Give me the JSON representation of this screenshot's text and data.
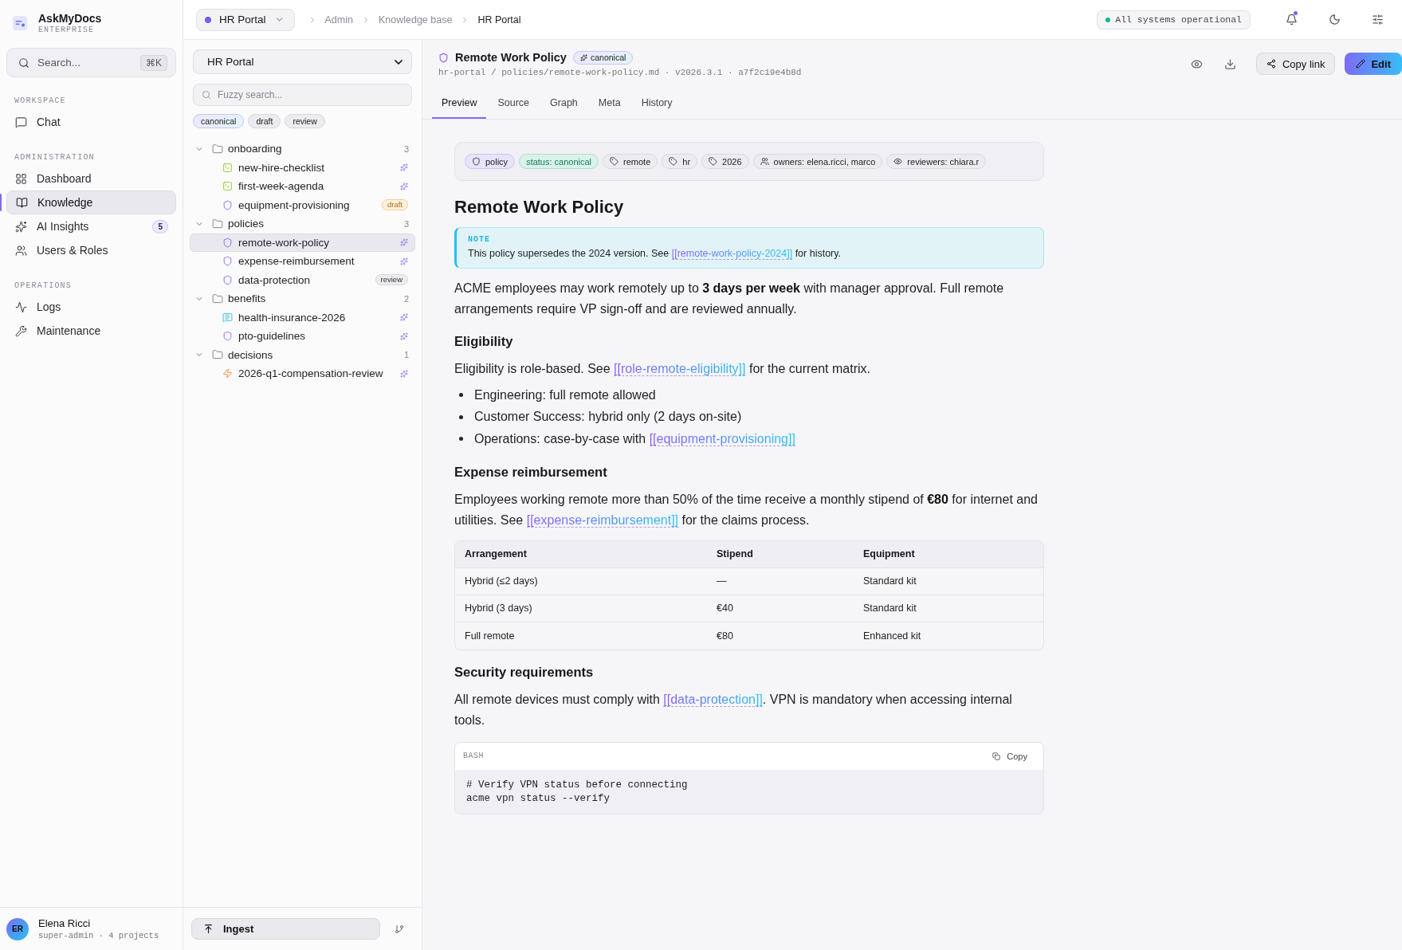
{
  "app": {
    "name": "AskMyDocs",
    "edition": "ENTERPRISE"
  },
  "sidebar": {
    "search": {
      "placeholder": "Search...",
      "shortcut": "⌘K"
    },
    "sections": [
      {
        "title": "WORKSPACE",
        "items": [
          {
            "label": "Chat",
            "selected": false
          }
        ]
      },
      {
        "title": "ADMINISTRATION",
        "items": [
          {
            "label": "Dashboard",
            "selected": false
          },
          {
            "label": "Knowledge",
            "selected": true
          },
          {
            "label": "AI Insights",
            "selected": false,
            "badge": "5"
          },
          {
            "label": "Users & Roles",
            "selected": false
          }
        ]
      },
      {
        "title": "OPERATIONS",
        "items": [
          {
            "label": "Logs",
            "selected": false
          },
          {
            "label": "Maintenance",
            "selected": false
          }
        ]
      }
    ]
  },
  "user": {
    "initials": "ER",
    "name": "Elena Ricci",
    "meta": "super-admin · 4 projects"
  },
  "topbar": {
    "project": "HR Portal",
    "breadcrumbs": [
      "Admin",
      "Knowledge base",
      "HR Portal"
    ],
    "status": "All systems operational",
    "unread_notifications": true
  },
  "tree_panel": {
    "project_select": "HR Portal",
    "search": {
      "placeholder": "Fuzzy search..."
    },
    "filters": [
      {
        "label": "canonical",
        "selected": true
      },
      {
        "label": "draft",
        "selected": false
      },
      {
        "label": "review",
        "selected": false
      }
    ],
    "folders": [
      {
        "name": "onboarding",
        "count": "3",
        "expanded": true,
        "children": [
          {
            "name": "new-hire-checklist",
            "kind": "terminal",
            "selected": false
          },
          {
            "name": "first-week-agenda",
            "kind": "terminal",
            "selected": false
          },
          {
            "name": "equipment-provisioning",
            "kind": "shield",
            "selected": false,
            "badge": {
              "label": "draft",
              "kind": "warning"
            }
          }
        ]
      },
      {
        "name": "policies",
        "count": "3",
        "expanded": true,
        "children": [
          {
            "name": "remote-work-policy",
            "kind": "shield",
            "selected": true
          },
          {
            "name": "expense-reimbursement",
            "kind": "shield",
            "selected": false
          },
          {
            "name": "data-protection",
            "kind": "shield",
            "selected": false,
            "badge": {
              "label": "review",
              "kind": "neutral"
            }
          }
        ]
      },
      {
        "name": "benefits",
        "count": "2",
        "expanded": true,
        "children": [
          {
            "name": "health-insurance-2026",
            "kind": "chat",
            "selected": false
          },
          {
            "name": "pto-guidelines",
            "kind": "shield",
            "selected": false
          }
        ]
      },
      {
        "name": "decisions",
        "count": "1",
        "expanded": true,
        "children": [
          {
            "name": "2026-q1-compensation-review",
            "kind": "bolt",
            "selected": false
          }
        ]
      }
    ],
    "ingest_button": "Ingest"
  },
  "document": {
    "title": "Remote Work Policy",
    "status": "canonical",
    "path": "hr-portal / policies/remote-work-policy.md · v2026.3.1 · a7f2c19e4b8d",
    "copy_link": "Copy link",
    "edit": "Edit",
    "tabs": [
      {
        "label": "Preview",
        "selected": true
      },
      {
        "label": "Source",
        "selected": false
      },
      {
        "label": "Graph",
        "selected": false
      },
      {
        "label": "Meta",
        "selected": false
      },
      {
        "label": "History",
        "selected": false
      }
    ],
    "meta_chips": [
      {
        "label": "policy",
        "kind": "type"
      },
      {
        "label": "status: canonical",
        "kind": "status"
      },
      {
        "label": "remote",
        "kind": "tag"
      },
      {
        "label": "hr",
        "kind": "tag"
      },
      {
        "label": "2026",
        "kind": "tag"
      },
      {
        "label": "owners: elena.ricci, marco",
        "kind": "owners"
      },
      {
        "label": "reviewers: chiara.r",
        "kind": "reviewers"
      }
    ],
    "heading": "Remote Work Policy",
    "note": {
      "label": "NOTE",
      "segments": [
        {
          "text": "This policy supersedes the 2024 version. See "
        },
        {
          "link": "[[remote-work-policy-2024]]"
        },
        {
          "text": " for history."
        }
      ]
    },
    "blocks": [
      {
        "kind": "paragraph",
        "segments": [
          {
            "text": "ACME employees may work remotely up to **3 days per week** with manager approval. Full remote arrangements require VP sign-off and are reviewed annually."
          }
        ]
      },
      {
        "kind": "heading",
        "text": "Eligibility"
      },
      {
        "kind": "paragraph",
        "segments": [
          {
            "text": "Eligibility is role-based. See "
          },
          {
            "link": "[[role-remote-eligibility]]"
          },
          {
            "text": " for the current matrix."
          }
        ]
      },
      {
        "kind": "list",
        "items": [
          [
            {
              "text": "Engineering: full remote allowed"
            }
          ],
          [
            {
              "text": "Customer Success: hybrid only (2 days on-site)"
            }
          ],
          [
            {
              "text": "Operations: case-by-case with "
            },
            {
              "link": "[[equipment-provisioning]]"
            }
          ]
        ]
      },
      {
        "kind": "heading",
        "text": "Expense reimbursement"
      },
      {
        "kind": "paragraph",
        "segments": [
          {
            "text": "Employees working remote more than 50% of the time receive a monthly stipend of **€80** for internet and utilities. See "
          },
          {
            "link": "[[expense-reimbursement]]"
          },
          {
            "text": " for the claims process."
          }
        ]
      },
      {
        "kind": "table",
        "columns": [
          "Arrangement",
          "Stipend",
          "Equipment"
        ],
        "rows": [
          [
            "Hybrid (≤2 days)",
            "—",
            "Standard kit"
          ],
          [
            "Hybrid (3 days)",
            "€40",
            "Standard kit"
          ],
          [
            "Full remote",
            "€80",
            "Enhanced kit"
          ]
        ]
      },
      {
        "kind": "heading",
        "text": "Security requirements"
      },
      {
        "kind": "paragraph",
        "segments": [
          {
            "text": "All remote devices must comply with "
          },
          {
            "link": "[[data-protection]]"
          },
          {
            "text": ". VPN is mandatory when accessing internal tools."
          }
        ]
      },
      {
        "kind": "code",
        "language": "BASH",
        "copy": "Copy",
        "lines": [
          "# Verify VPN status before connecting",
          "acme vpn status --verify"
        ]
      }
    ]
  }
}
